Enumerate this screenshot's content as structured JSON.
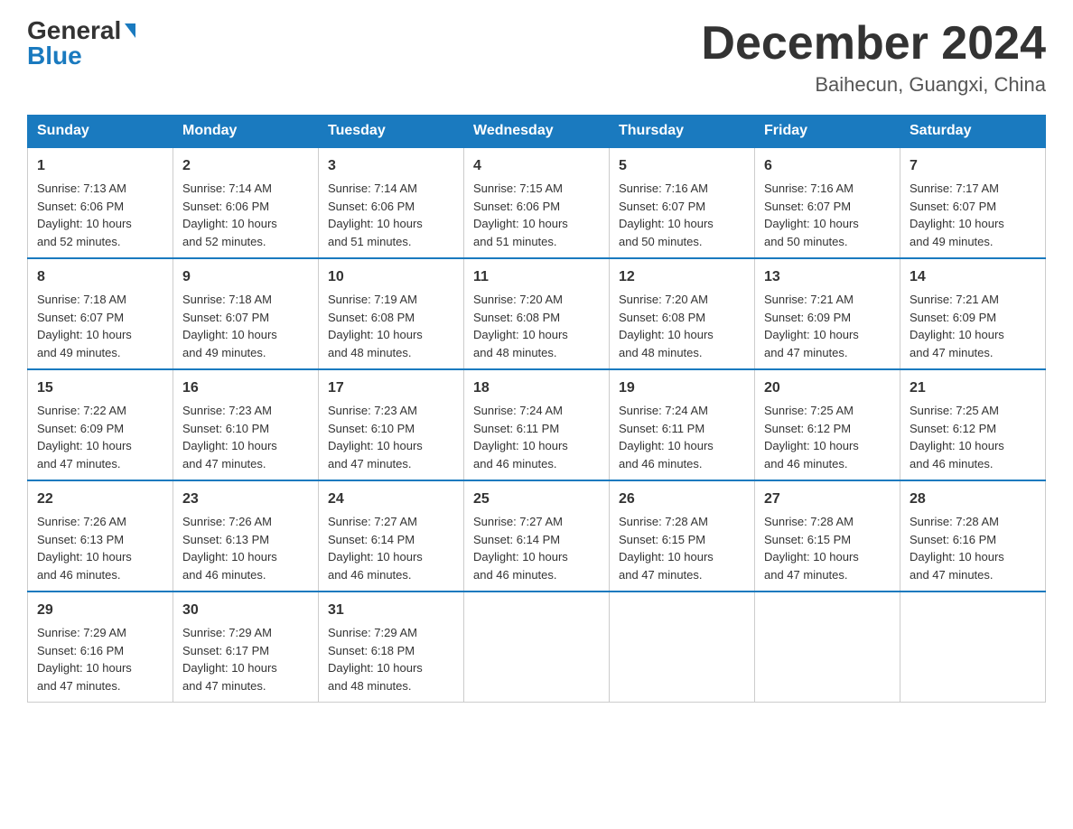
{
  "header": {
    "logo_general": "General",
    "logo_blue": "Blue",
    "month": "December 2024",
    "location": "Baihecun, Guangxi, China"
  },
  "days_of_week": [
    "Sunday",
    "Monday",
    "Tuesday",
    "Wednesday",
    "Thursday",
    "Friday",
    "Saturday"
  ],
  "weeks": [
    [
      {
        "day": "1",
        "sunrise": "7:13 AM",
        "sunset": "6:06 PM",
        "daylight": "10 hours and 52 minutes."
      },
      {
        "day": "2",
        "sunrise": "7:14 AM",
        "sunset": "6:06 PM",
        "daylight": "10 hours and 52 minutes."
      },
      {
        "day": "3",
        "sunrise": "7:14 AM",
        "sunset": "6:06 PM",
        "daylight": "10 hours and 51 minutes."
      },
      {
        "day": "4",
        "sunrise": "7:15 AM",
        "sunset": "6:06 PM",
        "daylight": "10 hours and 51 minutes."
      },
      {
        "day": "5",
        "sunrise": "7:16 AM",
        "sunset": "6:07 PM",
        "daylight": "10 hours and 50 minutes."
      },
      {
        "day": "6",
        "sunrise": "7:16 AM",
        "sunset": "6:07 PM",
        "daylight": "10 hours and 50 minutes."
      },
      {
        "day": "7",
        "sunrise": "7:17 AM",
        "sunset": "6:07 PM",
        "daylight": "10 hours and 49 minutes."
      }
    ],
    [
      {
        "day": "8",
        "sunrise": "7:18 AM",
        "sunset": "6:07 PM",
        "daylight": "10 hours and 49 minutes."
      },
      {
        "day": "9",
        "sunrise": "7:18 AM",
        "sunset": "6:07 PM",
        "daylight": "10 hours and 49 minutes."
      },
      {
        "day": "10",
        "sunrise": "7:19 AM",
        "sunset": "6:08 PM",
        "daylight": "10 hours and 48 minutes."
      },
      {
        "day": "11",
        "sunrise": "7:20 AM",
        "sunset": "6:08 PM",
        "daylight": "10 hours and 48 minutes."
      },
      {
        "day": "12",
        "sunrise": "7:20 AM",
        "sunset": "6:08 PM",
        "daylight": "10 hours and 48 minutes."
      },
      {
        "day": "13",
        "sunrise": "7:21 AM",
        "sunset": "6:09 PM",
        "daylight": "10 hours and 47 minutes."
      },
      {
        "day": "14",
        "sunrise": "7:21 AM",
        "sunset": "6:09 PM",
        "daylight": "10 hours and 47 minutes."
      }
    ],
    [
      {
        "day": "15",
        "sunrise": "7:22 AM",
        "sunset": "6:09 PM",
        "daylight": "10 hours and 47 minutes."
      },
      {
        "day": "16",
        "sunrise": "7:23 AM",
        "sunset": "6:10 PM",
        "daylight": "10 hours and 47 minutes."
      },
      {
        "day": "17",
        "sunrise": "7:23 AM",
        "sunset": "6:10 PM",
        "daylight": "10 hours and 47 minutes."
      },
      {
        "day": "18",
        "sunrise": "7:24 AM",
        "sunset": "6:11 PM",
        "daylight": "10 hours and 46 minutes."
      },
      {
        "day": "19",
        "sunrise": "7:24 AM",
        "sunset": "6:11 PM",
        "daylight": "10 hours and 46 minutes."
      },
      {
        "day": "20",
        "sunrise": "7:25 AM",
        "sunset": "6:12 PM",
        "daylight": "10 hours and 46 minutes."
      },
      {
        "day": "21",
        "sunrise": "7:25 AM",
        "sunset": "6:12 PM",
        "daylight": "10 hours and 46 minutes."
      }
    ],
    [
      {
        "day": "22",
        "sunrise": "7:26 AM",
        "sunset": "6:13 PM",
        "daylight": "10 hours and 46 minutes."
      },
      {
        "day": "23",
        "sunrise": "7:26 AM",
        "sunset": "6:13 PM",
        "daylight": "10 hours and 46 minutes."
      },
      {
        "day": "24",
        "sunrise": "7:27 AM",
        "sunset": "6:14 PM",
        "daylight": "10 hours and 46 minutes."
      },
      {
        "day": "25",
        "sunrise": "7:27 AM",
        "sunset": "6:14 PM",
        "daylight": "10 hours and 46 minutes."
      },
      {
        "day": "26",
        "sunrise": "7:28 AM",
        "sunset": "6:15 PM",
        "daylight": "10 hours and 47 minutes."
      },
      {
        "day": "27",
        "sunrise": "7:28 AM",
        "sunset": "6:15 PM",
        "daylight": "10 hours and 47 minutes."
      },
      {
        "day": "28",
        "sunrise": "7:28 AM",
        "sunset": "6:16 PM",
        "daylight": "10 hours and 47 minutes."
      }
    ],
    [
      {
        "day": "29",
        "sunrise": "7:29 AM",
        "sunset": "6:16 PM",
        "daylight": "10 hours and 47 minutes."
      },
      {
        "day": "30",
        "sunrise": "7:29 AM",
        "sunset": "6:17 PM",
        "daylight": "10 hours and 47 minutes."
      },
      {
        "day": "31",
        "sunrise": "7:29 AM",
        "sunset": "6:18 PM",
        "daylight": "10 hours and 48 minutes."
      },
      null,
      null,
      null,
      null
    ]
  ],
  "labels": {
    "sunrise": "Sunrise:",
    "sunset": "Sunset:",
    "daylight": "Daylight:"
  }
}
